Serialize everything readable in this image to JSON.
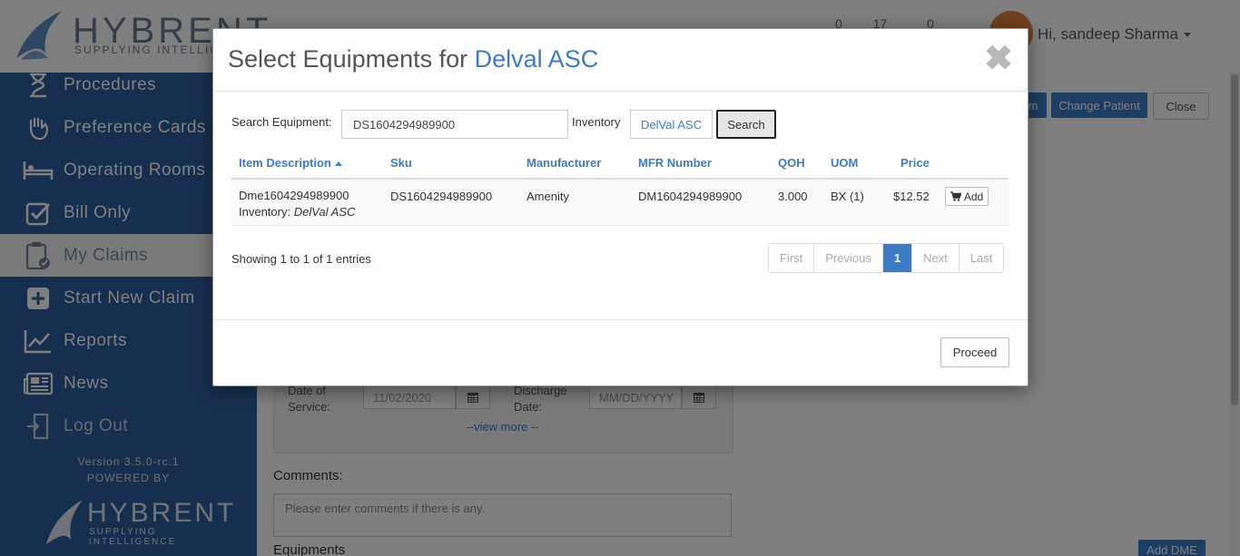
{
  "app": {
    "logo_text": "HYBRENT",
    "logo_sub": "SUPPLYING INTELLIGENCE",
    "top_counts": [
      "0",
      "17",
      "0"
    ],
    "user_greeting": "Hi, sandeep Sharma"
  },
  "sidebar": {
    "items": [
      {
        "label": "Procedures",
        "icon": "hourglass-icon"
      },
      {
        "label": "Preference Cards",
        "icon": "hand-icon"
      },
      {
        "label": "Operating Rooms",
        "icon": "bed-icon"
      },
      {
        "label": "Bill Only",
        "icon": "checkbox-icon"
      },
      {
        "label": "My Claims",
        "icon": "clipboard-check-icon"
      },
      {
        "label": "Start New Claim",
        "icon": "plus-square-icon"
      },
      {
        "label": "Reports",
        "icon": "line-chart-icon"
      },
      {
        "label": "News",
        "icon": "newspaper-icon"
      },
      {
        "label": "Log Out",
        "icon": "logout-icon"
      }
    ],
    "version": "Version 3.5.0-rc.1",
    "powered_by": "POWERED BY",
    "footer_logo": "HYBRENT",
    "footer_logo_sub": "SUPPLYING INTELLIGENCE"
  },
  "page": {
    "buttons": {
      "partial": "m",
      "change_patient": "Change Patient",
      "close": "Close"
    },
    "date_of_service_label": "Date of Service:",
    "date_of_service_value": "11/02/2020",
    "discharge_date_label": "Discharge Date:",
    "discharge_date_placeholder": "MM/DD/YYYY",
    "view_more": "--view more --",
    "comments_label": "Comments:",
    "comments_placeholder": "Please enter comments if there is any.",
    "equipments_label": "Equipments",
    "add_dme": "Add DME"
  },
  "modal": {
    "title_prefix": "Select Equipments for ",
    "title_accent": "Delval ASC",
    "close_symbol": "✖",
    "search_label": "Search Equipment:",
    "search_value": "DS1604294989900",
    "inventory_label": "Inventory",
    "inventory_value": "DelVal ASC",
    "search_button": "Search",
    "columns": {
      "description": "Item Description",
      "sku": "Sku",
      "manufacturer": "Manufacturer",
      "mfr_number": "MFR Number",
      "qoh": "QOH",
      "uom": "UOM",
      "price": "Price"
    },
    "rows": [
      {
        "description": "Dme1604294989900",
        "inventory_label": "Inventory:",
        "inventory": "DelVal ASC",
        "sku": "DS1604294989900",
        "manufacturer": "Amenity",
        "mfr_number": "DM1604294989900",
        "qoh": "3.000",
        "uom": "BX (1)",
        "price": "$12.52",
        "add_label": "Add"
      }
    ],
    "showing": "Showing 1 to 1 of 1 entries",
    "pager": {
      "first": "First",
      "previous": "Previous",
      "current": "1",
      "next": "Next",
      "last": "Last"
    },
    "proceed": "Proceed"
  },
  "colors": {
    "accent": "#3a7cc7",
    "sidebar": "#2e5f9f",
    "overlay": "rgba(0,0,0,0.5)"
  }
}
